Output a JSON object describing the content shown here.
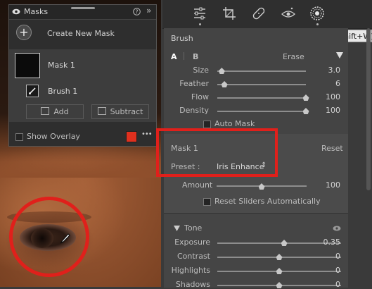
{
  "masks_panel": {
    "title": "Masks",
    "create_new_mask_label": "Create New Mask",
    "mask_name": "Mask 1",
    "brush_name": "Brush 1",
    "add_label": "Add",
    "subtract_label": "Subtract",
    "show_overlay_label": "Show Overlay",
    "overlay_color": "#e0301e",
    "more_label": "•••"
  },
  "toolbar": {
    "tools": [
      "edit-sliders-icon",
      "crop-icon",
      "healing-icon",
      "red-eye-icon",
      "masking-icon"
    ],
    "tooltip": "Masking (Shift+W)"
  },
  "brush": {
    "header": "Brush",
    "tab_a": "A",
    "tab_b": "B",
    "erase_label": "Erase",
    "sliders": [
      {
        "label": "Size",
        "value": "3.0",
        "level": 0.05
      },
      {
        "label": "Feather",
        "value": "6",
        "level": 0.08
      },
      {
        "label": "Flow",
        "value": "100",
        "level": 1.0
      },
      {
        "label": "Density",
        "value": "100",
        "level": 1.0
      }
    ],
    "auto_mask_label": "Auto Mask"
  },
  "mask_settings": {
    "mask_name": "Mask 1",
    "reset_label": "Reset",
    "preset_label": "Preset :",
    "preset_value": "Iris Enhance",
    "preset_arrows": "⇕",
    "amount_label": "Amount",
    "amount_value": "100",
    "amount_level": 0.5,
    "reset_sliders_label": "Reset Sliders Automatically"
  },
  "tone": {
    "header": "Tone",
    "sliders": [
      {
        "label": "Exposure",
        "value": "0.35",
        "level": 0.54
      },
      {
        "label": "Contrast",
        "value": "0",
        "level": 0.5
      },
      {
        "label": "Highlights",
        "value": "0",
        "level": 0.5
      },
      {
        "label": "Shadows",
        "value": "0",
        "level": 0.5
      }
    ]
  }
}
